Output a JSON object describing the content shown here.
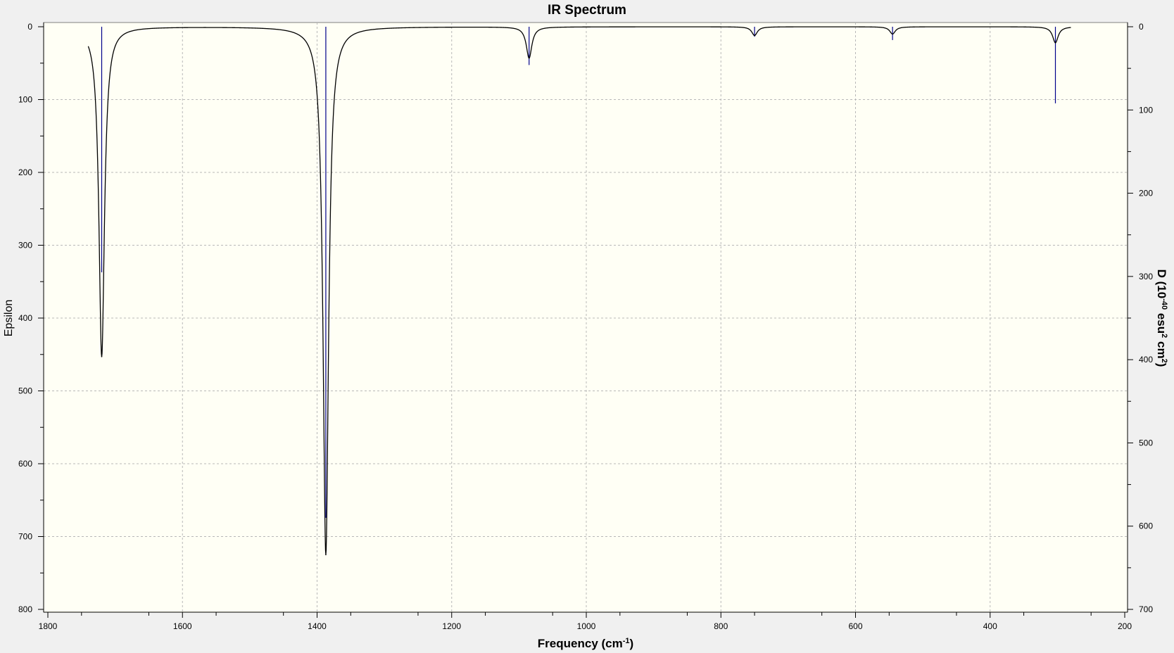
{
  "colors": {
    "window_bg": "#f0f0f0",
    "plot_bg": "#fffff5",
    "spectrum_line": "#000000",
    "stick_line": "#00008b",
    "grid": "#b8b8b8"
  },
  "chart_data": {
    "type": "line",
    "title": "IR Spectrum",
    "xlabel": "Frequency (cm⁻¹)",
    "xlabel_main": "Frequency (cm",
    "xlabel_sup": "-1",
    "xlabel_end": ")",
    "ylabel": "Epsilon",
    "y2label": "D (10⁻⁴⁰ esu² cm²)",
    "y2label_parts": {
      "a": "D (10",
      "b": "-40",
      "c": " esu",
      "d": "2",
      "e": " cm",
      "f": "2",
      "g": ")"
    },
    "xlim": [
      1800,
      200
    ],
    "x_reversed": true,
    "ylim": [
      0,
      800
    ],
    "y_inverted": true,
    "y2lim": [
      0,
      700
    ],
    "grid": true,
    "xticks": [
      "1800",
      "1600",
      "1400",
      "1200",
      "1000",
      "800",
      "600",
      "400",
      "200"
    ],
    "yticks": [
      "0",
      "100",
      "200",
      "300",
      "400",
      "500",
      "600",
      "700",
      "800"
    ],
    "y2ticks": [
      "0",
      "100",
      "200",
      "300",
      "400",
      "500",
      "600",
      "700"
    ],
    "x_range": [
      1740,
      280
    ],
    "hwhm": 5,
    "peaks": [
      {
        "x": 1720,
        "epsilon": 453
      },
      {
        "x": 1387,
        "epsilon": 725
      },
      {
        "x": 1085,
        "epsilon": 43
      },
      {
        "x": 750,
        "epsilon": 12
      },
      {
        "x": 545,
        "epsilon": 10
      },
      {
        "x": 303,
        "epsilon": 22
      }
    ],
    "sticks": [
      {
        "x": 1720,
        "D": 295
      },
      {
        "x": 1387,
        "D": 590
      },
      {
        "x": 1085,
        "D": 46
      },
      {
        "x": 750,
        "D": 12
      },
      {
        "x": 545,
        "D": 16
      },
      {
        "x": 303,
        "D": 92
      }
    ],
    "series": [
      {
        "type": "line",
        "values_ref": "peaks"
      },
      {
        "type": "stick",
        "values_ref": "sticks"
      }
    ]
  }
}
